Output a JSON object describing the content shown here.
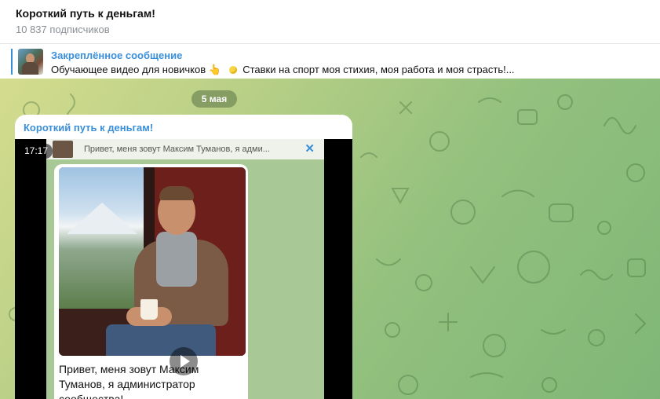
{
  "header": {
    "title": "Короткий путь к деньгам!",
    "subscribers": "10 837 подписчиков"
  },
  "pinned": {
    "label": "Закреплённое сообщение",
    "text_before": "Обучающее видео для новичков",
    "hand_emoji": "👆",
    "text_after": "Ставки на спорт моя стихия, моя работа и моя страсть!..."
  },
  "chat": {
    "date_pill": "5 мая",
    "message": {
      "author": "Короткий путь к деньгам!",
      "video_duration": "17:17",
      "video_reply_text": "Привет, меня зовут Максим Туманов, я адми...",
      "video_reply_close": "✕",
      "video_post_text": "Привет, меня зовут Максим Туманов, я администратор сообщества!"
    }
  },
  "colors": {
    "accent": "#3a8fd9",
    "chat_bg_left": "#d4dc8e",
    "chat_bg_right": "#7fb677"
  }
}
